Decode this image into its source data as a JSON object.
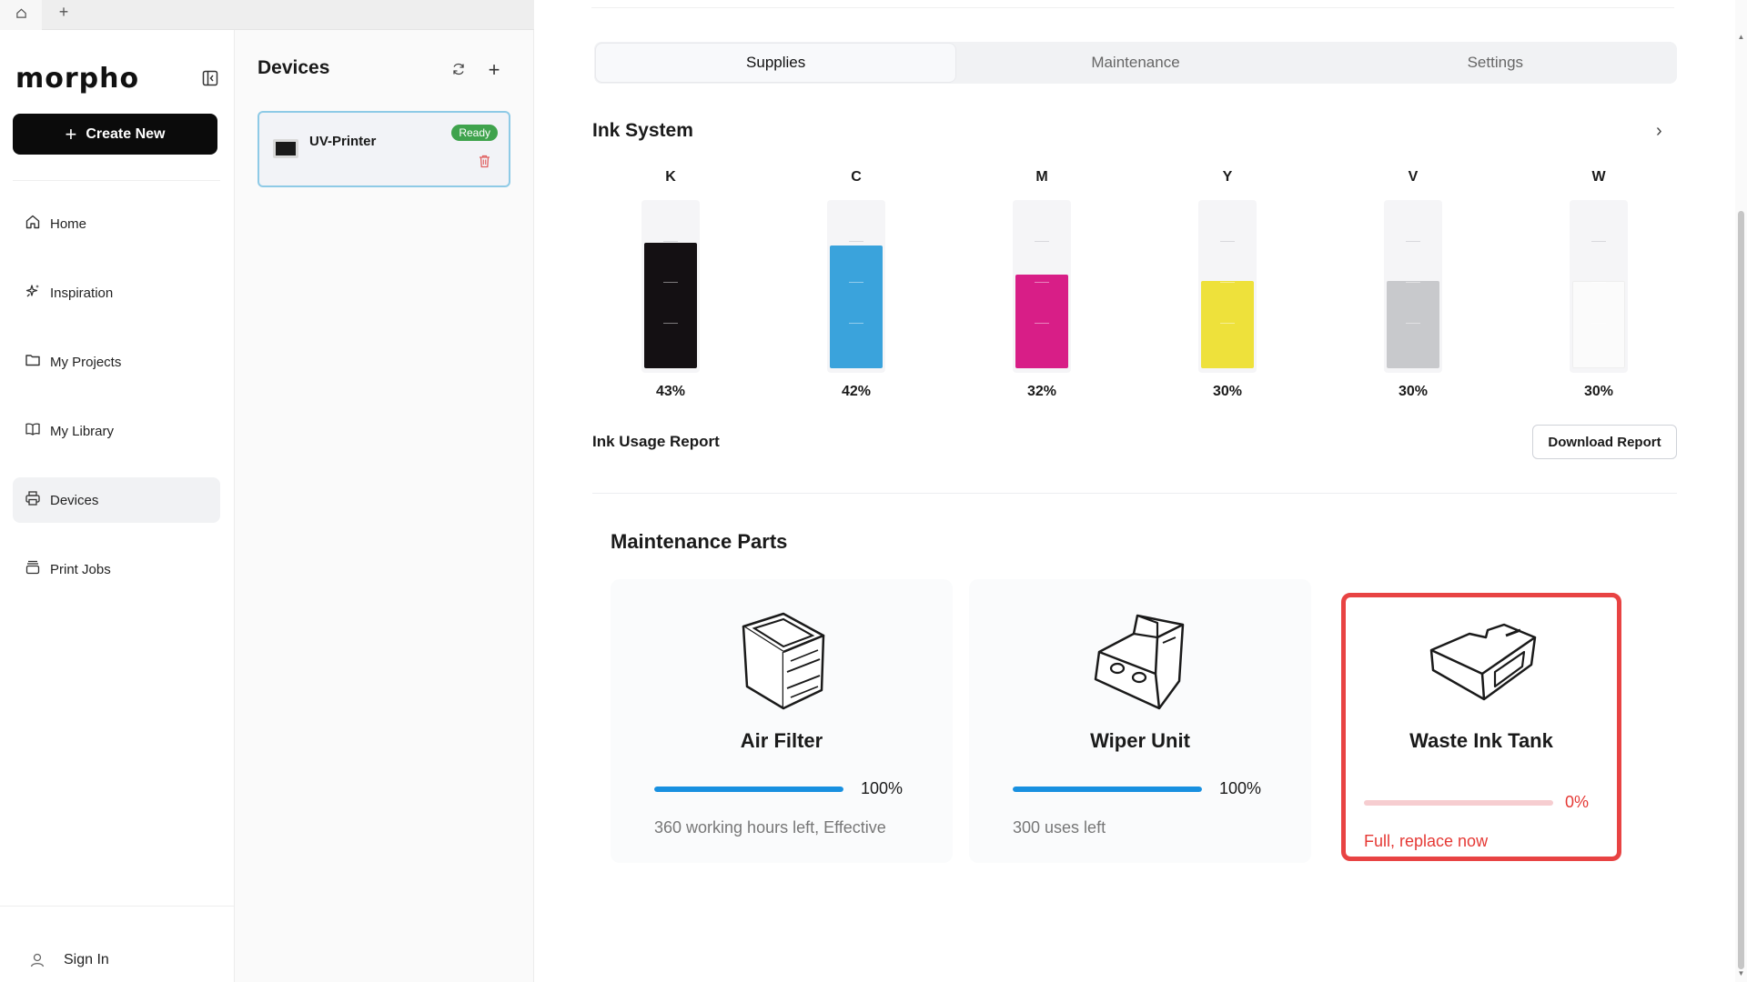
{
  "browser": {
    "home_tab_icon": "home-icon",
    "new_tab_label": "+"
  },
  "sidebar": {
    "logo": "morpho",
    "create_label": "Create New",
    "items": [
      {
        "label": "Home",
        "icon": "home-icon"
      },
      {
        "label": "Inspiration",
        "icon": "sparkle-icon"
      },
      {
        "label": "My Projects",
        "icon": "folder-icon"
      },
      {
        "label": "My Library",
        "icon": "book-icon"
      },
      {
        "label": "Devices",
        "icon": "printer-icon",
        "active": true
      },
      {
        "label": "Print Jobs",
        "icon": "stack-icon"
      }
    ],
    "sign_in": "Sign In"
  },
  "devices": {
    "title": "Devices",
    "list": [
      {
        "name": "UV-Printer",
        "status": "Ready"
      }
    ]
  },
  "main": {
    "tabs": [
      {
        "label": "Supplies",
        "active": true
      },
      {
        "label": "Maintenance"
      },
      {
        "label": "Settings"
      }
    ],
    "ink_title": "Ink System",
    "inks": [
      {
        "letter": "K",
        "pct": "43%",
        "level": 0.43,
        "color": "#141013"
      },
      {
        "letter": "C",
        "pct": "42%",
        "level": 0.42,
        "color": "#3aa3dc"
      },
      {
        "letter": "M",
        "pct": "32%",
        "level": 0.32,
        "color": "#d81e87"
      },
      {
        "letter": "Y",
        "pct": "30%",
        "level": 0.3,
        "color": "#eee13b"
      },
      {
        "letter": "V",
        "pct": "30%",
        "level": 0.3,
        "color": "#c8c9cc"
      },
      {
        "letter": "W",
        "pct": "30%",
        "level": 0.3,
        "color": "#fbfbfb"
      }
    ],
    "usage_label": "Ink Usage Report",
    "download_label": "Download Report",
    "parts_title": "Maintenance Parts",
    "parts": [
      {
        "name": "Air Filter",
        "pct": "100%",
        "level": 1.0,
        "status": "360 working hours left, Effective",
        "alert": false
      },
      {
        "name": "Wiper Unit",
        "pct": "100%",
        "level": 1.0,
        "status": "300 uses left",
        "alert": false
      },
      {
        "name": "Waste Ink Tank",
        "pct": "0%",
        "level": 0.0,
        "status": "Full, replace now",
        "alert": true
      }
    ]
  },
  "colors": {
    "accent": "#1890e0",
    "alert": "#e84343",
    "ready": "#3fa34d",
    "selected_border": "#8ecae6"
  }
}
